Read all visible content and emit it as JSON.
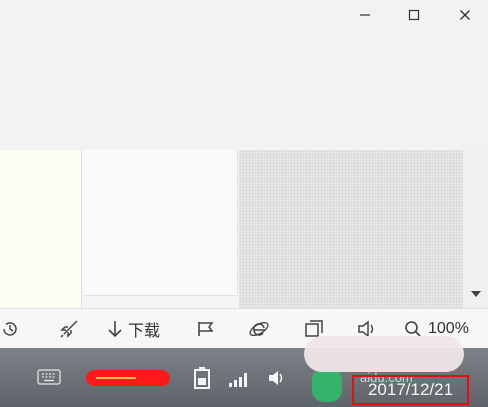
{
  "window": {
    "minimize_glyph": "–",
    "maximize_icon": "maximize-icon",
    "close_icon": "close-icon"
  },
  "statusbar": {
    "items": [
      {
        "icon": "refresh-icon"
      },
      {
        "icon": "rocket-icon"
      },
      {
        "icon": "download-icon",
        "label": "下载"
      },
      {
        "icon": "flag-icon"
      },
      {
        "icon": "ie-icon"
      },
      {
        "icon": "window-icon"
      },
      {
        "icon": "speaker-icon"
      },
      {
        "icon": "zoom-icon",
        "label": "100%"
      }
    ]
  },
  "taskbar": {
    "watermark": "aidu.com",
    "date": "2017/12/21"
  },
  "colors": {
    "highlight_box": "#e01010",
    "redaction": "#ff1a1a",
    "taskbar": "#6d7378"
  }
}
